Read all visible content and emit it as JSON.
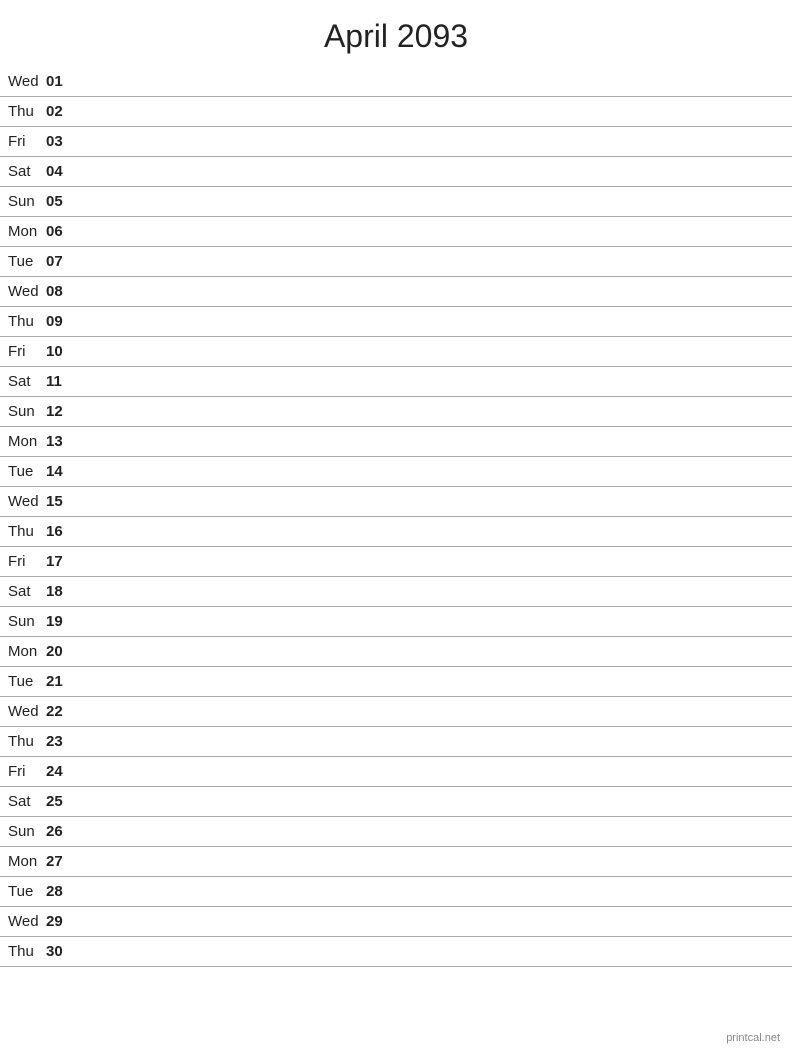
{
  "title": "April 2093",
  "footer": "printcal.net",
  "days": [
    {
      "abbr": "Wed",
      "num": "01"
    },
    {
      "abbr": "Thu",
      "num": "02"
    },
    {
      "abbr": "Fri",
      "num": "03"
    },
    {
      "abbr": "Sat",
      "num": "04"
    },
    {
      "abbr": "Sun",
      "num": "05"
    },
    {
      "abbr": "Mon",
      "num": "06"
    },
    {
      "abbr": "Tue",
      "num": "07"
    },
    {
      "abbr": "Wed",
      "num": "08"
    },
    {
      "abbr": "Thu",
      "num": "09"
    },
    {
      "abbr": "Fri",
      "num": "10"
    },
    {
      "abbr": "Sat",
      "num": "11"
    },
    {
      "abbr": "Sun",
      "num": "12"
    },
    {
      "abbr": "Mon",
      "num": "13"
    },
    {
      "abbr": "Tue",
      "num": "14"
    },
    {
      "abbr": "Wed",
      "num": "15"
    },
    {
      "abbr": "Thu",
      "num": "16"
    },
    {
      "abbr": "Fri",
      "num": "17"
    },
    {
      "abbr": "Sat",
      "num": "18"
    },
    {
      "abbr": "Sun",
      "num": "19"
    },
    {
      "abbr": "Mon",
      "num": "20"
    },
    {
      "abbr": "Tue",
      "num": "21"
    },
    {
      "abbr": "Wed",
      "num": "22"
    },
    {
      "abbr": "Thu",
      "num": "23"
    },
    {
      "abbr": "Fri",
      "num": "24"
    },
    {
      "abbr": "Sat",
      "num": "25"
    },
    {
      "abbr": "Sun",
      "num": "26"
    },
    {
      "abbr": "Mon",
      "num": "27"
    },
    {
      "abbr": "Tue",
      "num": "28"
    },
    {
      "abbr": "Wed",
      "num": "29"
    },
    {
      "abbr": "Thu",
      "num": "30"
    }
  ]
}
